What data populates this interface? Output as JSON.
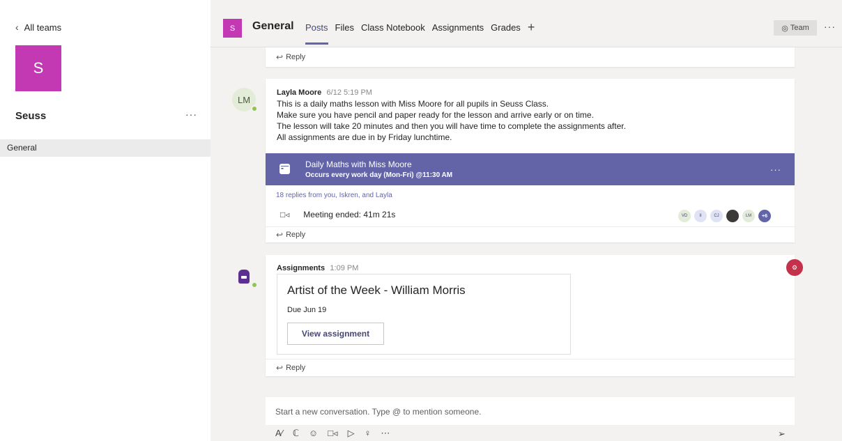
{
  "sidebar": {
    "back_label": "All teams",
    "team_initial": "S",
    "team_name": "Seuss",
    "more": "···",
    "channels": [
      "General"
    ]
  },
  "header": {
    "channel_initial": "S",
    "channel_name": "General",
    "tabs": [
      "Posts",
      "Files",
      "Class Notebook",
      "Assignments",
      "Grades"
    ],
    "active_tab": "Posts",
    "add_tab": "+",
    "team_button": "Team",
    "more": "···"
  },
  "reply_label": "Reply",
  "post1": {
    "avatar_initials": "LM",
    "author": "Layla Moore",
    "time": "6/12 5:19 PM",
    "lines": [
      "This is a daily maths lesson with Miss Moore for all pupils in Seuss Class.",
      "Make sure you have pencil and paper ready for the lesson and arrive early or on time.",
      "The lesson will take 20 minutes and then you will have time to complete the assignments after.",
      "All assignments are due in by Friday lunchtime."
    ],
    "meeting": {
      "title": "Daily Maths with Miss Moore",
      "subtitle": "Occurs every work day (Mon-Fri) @11:30 AM",
      "more": "···"
    },
    "replies_summary": "18 replies from you, Iskren, and Layla",
    "meeting_ended": "Meeting ended: 41m 21s",
    "participants": [
      "VD",
      "II",
      "CJ",
      "",
      "LM",
      "+6"
    ]
  },
  "post2": {
    "author": "Assignments",
    "time": "1:09 PM",
    "assignment": {
      "title": "Artist of the Week - William Morris",
      "due": "Due Jun 19",
      "button": "View assignment"
    }
  },
  "compose": {
    "placeholder": "Start a new conversation. Type @ to mention someone."
  },
  "icons": {
    "back": "chevron-left-icon",
    "team_view": "eye-icon",
    "reply": "reply-arrow-icon",
    "meeting": "calendar-icon",
    "camera": "video-camera-icon",
    "send": "send-icon"
  },
  "colors": {
    "brand": "#6264a7",
    "team_avatar": "#c239b3",
    "presence": "#92c353",
    "reaction_badge": "#c4314b"
  }
}
